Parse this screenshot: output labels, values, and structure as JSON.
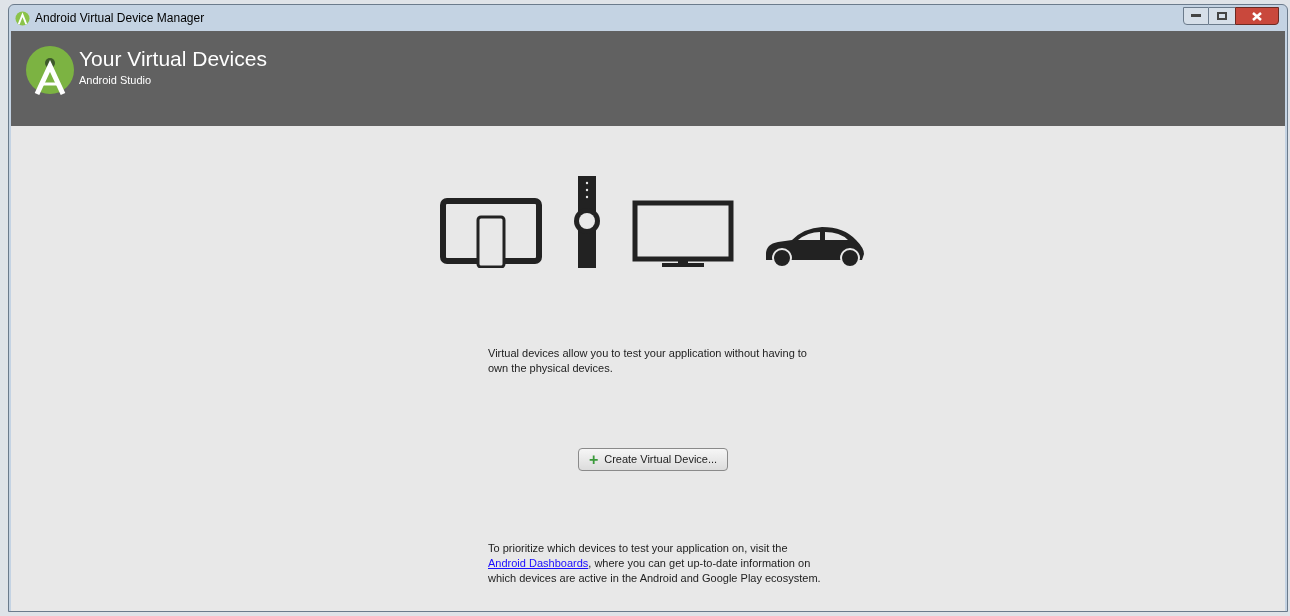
{
  "window": {
    "title": "Android Virtual Device Manager"
  },
  "header": {
    "title": "Your Virtual Devices",
    "subtitle": "Android Studio"
  },
  "intro": "Virtual devices allow you to test your application without having to own the physical devices.",
  "create_button": {
    "icon": "+",
    "label": "Create Virtual Device..."
  },
  "footer": {
    "before": "To prioritize which devices to test your application on, visit the ",
    "link": "Android Dashboards",
    "after": ", where you can get up-to-date information on which devices are active in the Android and Google Play ecosystem."
  }
}
